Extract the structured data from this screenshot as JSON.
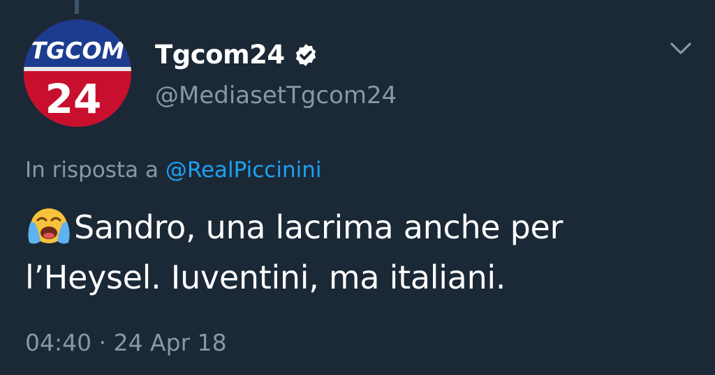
{
  "author": {
    "display_name": "Tgcom24",
    "handle": "@MediasetTgcom24",
    "verified": true,
    "avatar_logo_top": "TGCOM",
    "avatar_logo_number": "24"
  },
  "reply": {
    "prefix": "In risposta a",
    "handle": "@RealPiccinini"
  },
  "tweet": {
    "emoji": "loudly-crying-face",
    "line1": "Sandro, una lacrima anche per",
    "line2": "l’Heysel. Iuventini, ma italiani."
  },
  "meta": {
    "timestamp": "04:40 · 24 Apr 18"
  },
  "colors": {
    "background": "#1b2836",
    "secondary_text": "#8899a6",
    "link": "#1da1f2",
    "avatar_blue": "#1b3c8f",
    "avatar_red": "#c8102e"
  }
}
